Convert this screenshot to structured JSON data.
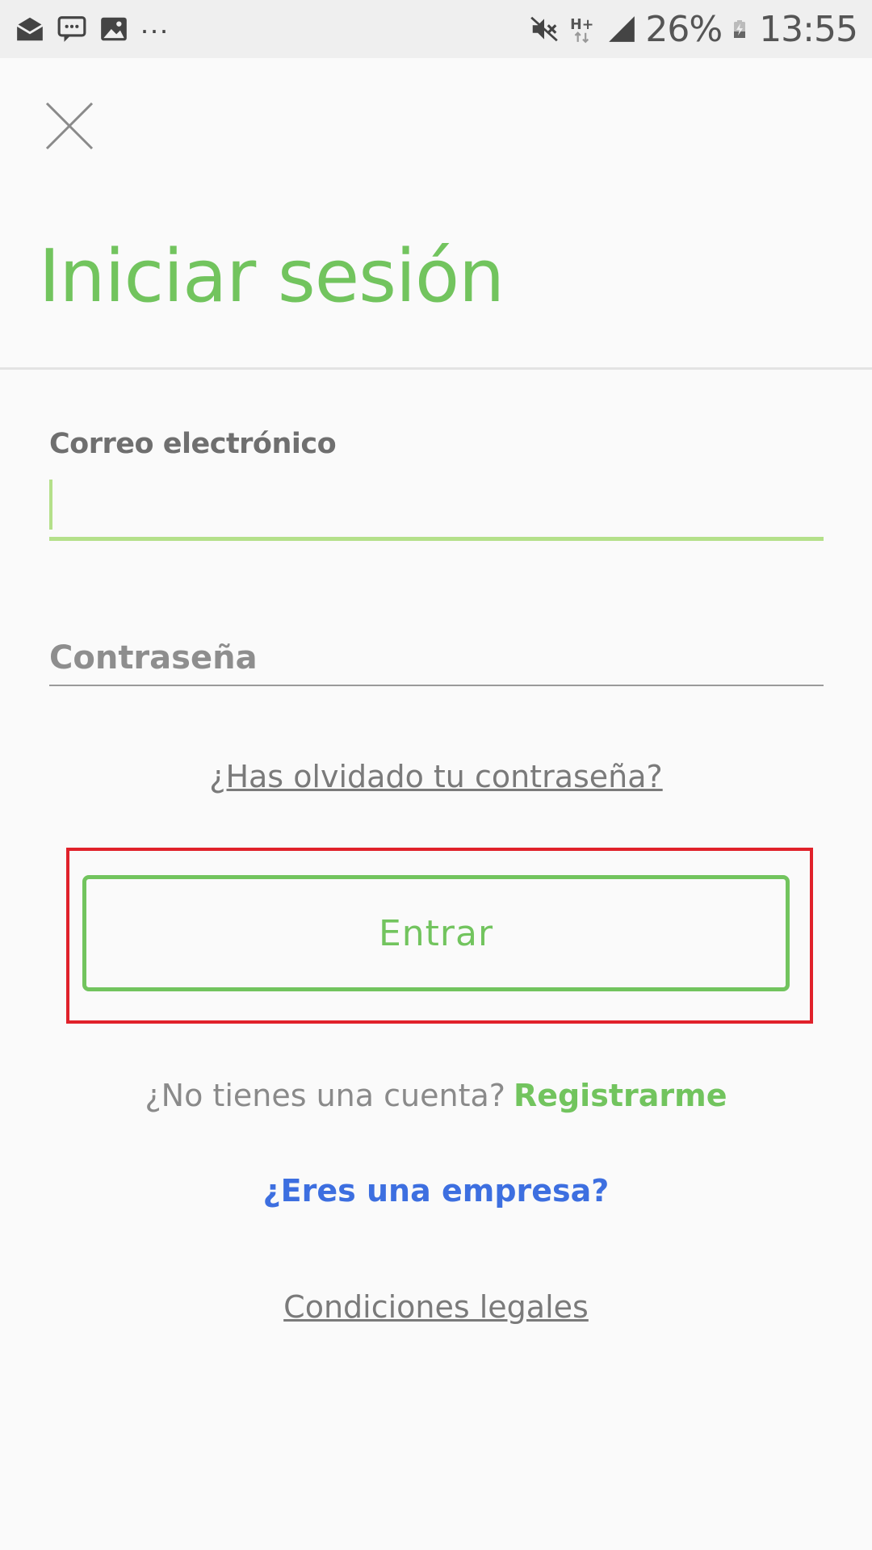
{
  "status_bar": {
    "left_icons": [
      "mail-icon",
      "message-sync-icon",
      "gallery-icon"
    ],
    "overflow": "...",
    "right_icons": [
      "mute-icon",
      "network-hplus-icon",
      "signal-icon",
      "battery-charging-icon"
    ],
    "battery": "26%",
    "time": "13:55"
  },
  "header": {
    "close_icon": "close-icon",
    "title": "Iniciar sesión"
  },
  "form": {
    "email_label": "Correo electrónico",
    "email_value": "",
    "password_placeholder": "Contraseña",
    "forgot_password": "¿Has olvidado tu contraseña?",
    "submit_label": "Entrar"
  },
  "footer": {
    "no_account_text": "¿No tienes una cuenta?",
    "register_link": "Registrarme",
    "business_link": "¿Eres una empresa?",
    "legal_link": "Condiciones legales"
  },
  "colors": {
    "brand_green": "#72c45e",
    "focus_green": "#b4e08a",
    "link_blue": "#3d6fe0",
    "highlight_red": "#e0212a",
    "background": "#fafafa"
  }
}
